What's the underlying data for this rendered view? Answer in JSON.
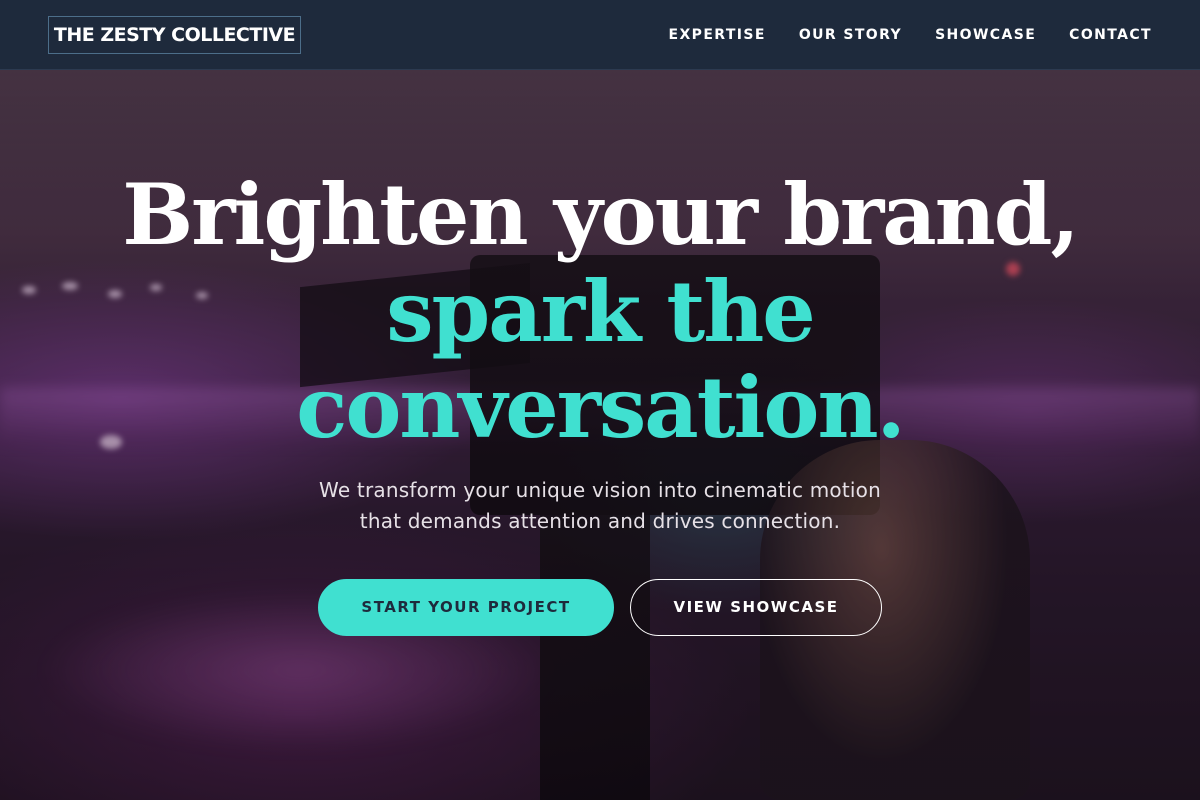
{
  "navbar": {
    "brand": "THE ZESTY COLLECTIVE",
    "links": [
      {
        "label": "EXPERTISE"
      },
      {
        "label": "OUR STORY"
      },
      {
        "label": "SHOWCASE"
      },
      {
        "label": "CONTACT"
      }
    ]
  },
  "hero": {
    "headline_line1": "Brighten your brand,",
    "headline_line2": "spark the",
    "headline_line3": "conversation.",
    "subtitle_line1": "We transform your unique vision into cinematic motion",
    "subtitle_line2": "that demands attention and drives connection.",
    "primary_button": "START YOUR PROJECT",
    "secondary_button": "VIEW SHOWCASE"
  },
  "colors": {
    "navbar_bg": "#1e2a3c",
    "accent": "#40e0d0",
    "text_light": "#ffffff"
  }
}
